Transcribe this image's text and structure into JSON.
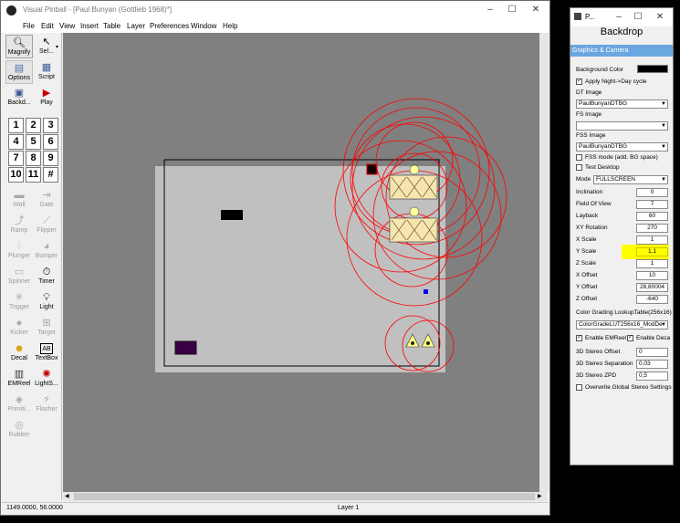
{
  "window": {
    "title": "Visual Pinball - [Paul Bunyan (Gottlieb 1968)*]",
    "controls": [
      "–",
      "☐",
      "✕"
    ]
  },
  "menu": [
    "File",
    "Edit",
    "View",
    "Insert",
    "Table",
    "Layer",
    "Preferences",
    "Window",
    "Help"
  ],
  "toolbar": {
    "row1": [
      {
        "label": "Magnify",
        "icon": "magnify-icon"
      },
      {
        "label": "Sel...",
        "icon": "select-arrow-icon"
      }
    ],
    "row2": [
      {
        "label": "Options",
        "icon": "options-icon"
      },
      {
        "label": "Script",
        "icon": "script-icon"
      }
    ],
    "row3": [
      {
        "label": "Backd...",
        "icon": "backdrop-icon"
      },
      {
        "label": "Play",
        "icon": "play-icon"
      }
    ],
    "numbers": [
      "1",
      "2",
      "3",
      "4",
      "5",
      "6",
      "7",
      "8",
      "9",
      "10",
      "11",
      "#"
    ],
    "tools": [
      {
        "label": "Wall",
        "enabled": false
      },
      {
        "label": "Gate",
        "enabled": false
      },
      {
        "label": "Ramp",
        "enabled": false
      },
      {
        "label": "Flipper",
        "enabled": false
      },
      {
        "label": "Plunger",
        "enabled": false
      },
      {
        "label": "Bumper",
        "enabled": false
      },
      {
        "label": "Spinner",
        "enabled": false
      },
      {
        "label": "Timer",
        "enabled": true
      },
      {
        "label": "Trigger",
        "enabled": false
      },
      {
        "label": "Light",
        "enabled": true
      },
      {
        "label": "Kicker",
        "enabled": false
      },
      {
        "label": "Target",
        "enabled": false
      },
      {
        "label": "Decal",
        "enabled": true
      },
      {
        "label": "TextBox",
        "enabled": true
      },
      {
        "label": "EMReel",
        "enabled": true
      },
      {
        "label": "LightS...",
        "enabled": true
      },
      {
        "label": "Primiti...",
        "enabled": false
      },
      {
        "label": "Flasher",
        "enabled": false
      },
      {
        "label": "Rubber",
        "enabled": false
      }
    ]
  },
  "status": {
    "coords": "1149.0000, 56.0000",
    "layer": "Layer 1"
  },
  "panel": {
    "title": "P...",
    "header": "Backdrop",
    "tab": "Graphics & Camera",
    "background_color_label": "Background Color",
    "background_color": "#000000",
    "apply_day_night_label": "Apply Night->Day cycle",
    "apply_day_night": true,
    "dt_image_label": "DT Image",
    "dt_image": "PaulBunyanDTBG",
    "fs_image_label": "FS Image",
    "fs_image": "",
    "fss_image_label": "FSS Image",
    "fss_image": "PaulBunyanDTBG",
    "fss_mode_label": "FSS mode (add. BG space)",
    "fss_mode": false,
    "test_desktop_label": "Test Desktop",
    "test_desktop": false,
    "mode_label": "Mode",
    "mode": "FULLSCREEN",
    "fields": [
      {
        "label": "Inclination",
        "value": "0"
      },
      {
        "label": "Field Of View",
        "value": "7"
      },
      {
        "label": "Layback",
        "value": "60"
      },
      {
        "label": "XY Rotation",
        "value": "270"
      },
      {
        "label": "X Scale",
        "value": "1"
      },
      {
        "label": "Y Scale",
        "value": "1,1"
      },
      {
        "label": "Z Scale",
        "value": "1"
      },
      {
        "label": "X Offset",
        "value": "10"
      },
      {
        "label": "Y Offset",
        "value": "28,80004"
      },
      {
        "label": "Z Offset",
        "value": "-640"
      }
    ],
    "highlight_color": "#ffff00",
    "lut_label": "Color Grading LookupTable(256x16)",
    "lut": "ColorGradeLUT256x16_ModDe",
    "enable_emreel_label": "Enable EMReel",
    "enable_emreel": true,
    "enable_decal_label": "Enable Deca",
    "enable_decal": true,
    "stereo_fields": [
      {
        "label": "3D Stereo Offset",
        "value": "0"
      },
      {
        "label": "3D Stereo Separation",
        "value": "0,03"
      },
      {
        "label": "3D Stereo ZPD",
        "value": "0,5"
      }
    ],
    "overwrite_stereo_label": "Overwrite Global Stereo Settings",
    "overwrite_stereo": false
  },
  "colors": {
    "canvas": "#808080",
    "playfield": "#c0c0c0",
    "circle": "#ff0000",
    "flasher": "#3a0044",
    "marker": "#0000ff"
  }
}
